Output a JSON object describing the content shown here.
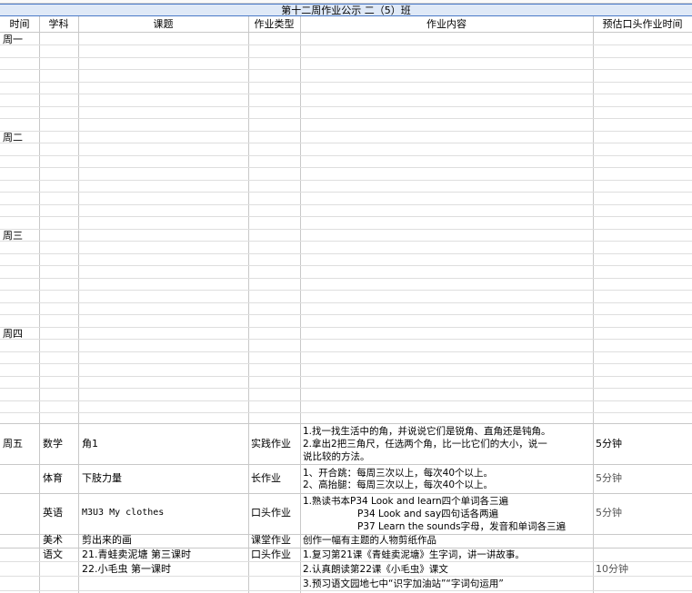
{
  "sheet_title": "第十二周作业公示 二（5）班",
  "headers": {
    "time": "时间",
    "subject": "学科",
    "topic": "课题",
    "type": "作业类型",
    "content": "作业内容",
    "duration": "预估口头作业时间"
  },
  "days": {
    "mon": "周一",
    "tue": "周二",
    "wed": "周三",
    "thu": "周四",
    "fri": "周五"
  },
  "friday": {
    "math": {
      "subject": "数学",
      "topic": "角1",
      "type": "实践作业",
      "content": [
        "1.找一找生活中的角，并说说它们是锐角、直角还是钝角。",
        "2.拿出2把三角尺，任选两个角，比一比它们的大小，说一",
        "说比较的方法。"
      ],
      "duration": "5分钟"
    },
    "pe": {
      "subject": "体育",
      "topic": "下肢力量",
      "type": "长作业",
      "content": [
        "1、开合跳：每周三次以上，每次40个以上。",
        "2、高抬腿：每周三次以上，每次40个以上。"
      ],
      "duration": "5分钟"
    },
    "english": {
      "subject": "英语",
      "topic": "M3U3 My clothes",
      "type": "口头作业",
      "content": [
        "1.熟读书本P34 Look and learn四个单词各三遍",
        "P34 Look and say四句话各两遍",
        "P37 Learn the sounds字母，发音和单词各三遍"
      ],
      "duration": "5分钟"
    },
    "art": {
      "subject": "美术",
      "topic": "剪出来的画",
      "type": "课堂作业",
      "content": [
        "创作一幅有主题的人物剪纸作品"
      ]
    },
    "chinese": {
      "subject": "语文",
      "topic": "21.青蛙卖泥塘 第三课时",
      "topic2": "22.小毛虫 第一课时",
      "type": "口头作业",
      "content": [
        "1.复习第21课《青蛙卖泥塘》生字词，讲一讲故事。",
        "2.认真朗读第22课《小毛虫》课文",
        "3.预习语文园地七中“识字加油站”“字词句运用”"
      ],
      "duration": "10分钟"
    }
  }
}
